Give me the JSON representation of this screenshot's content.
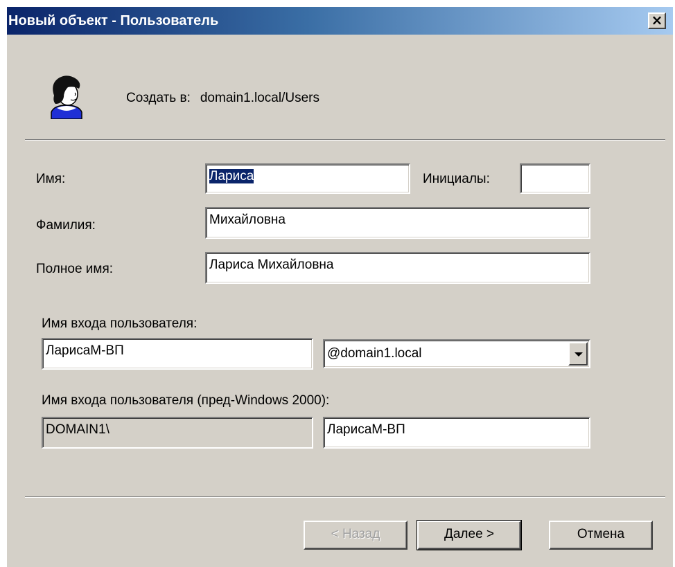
{
  "window": {
    "title": "Новый объект - Пользователь",
    "close_glyph": "×"
  },
  "header": {
    "icon": "user-icon",
    "create_in_label": "Создать в:",
    "create_in_path": "domain1.local/Users"
  },
  "form": {
    "first_name": {
      "label": "Имя:",
      "value": "Лариса"
    },
    "initials": {
      "label": "Инициалы:",
      "value": ""
    },
    "last_name": {
      "label": "Фамилия:",
      "value": "Михайловна"
    },
    "full_name": {
      "label": "Полное имя:",
      "value": "Лариса Михайловна"
    },
    "logon_name": {
      "label": "Имя входа пользователя:",
      "value": "ЛарисаМ-ВП",
      "domain_selected": "@domain1.local"
    },
    "logon_pre2000": {
      "label": "Имя входа пользователя (пред-Windows 2000):",
      "domain_prefix": "DOMAIN1\\",
      "value": "ЛарисаМ-ВП"
    }
  },
  "buttons": {
    "back": "< Назад",
    "next": "Далее >",
    "cancel": "Отмена"
  },
  "colors": {
    "titlebar_start": "#0a246a",
    "titlebar_end": "#a6caf0",
    "dialog_face": "#d4d0c8",
    "selection": "#0a246a"
  }
}
